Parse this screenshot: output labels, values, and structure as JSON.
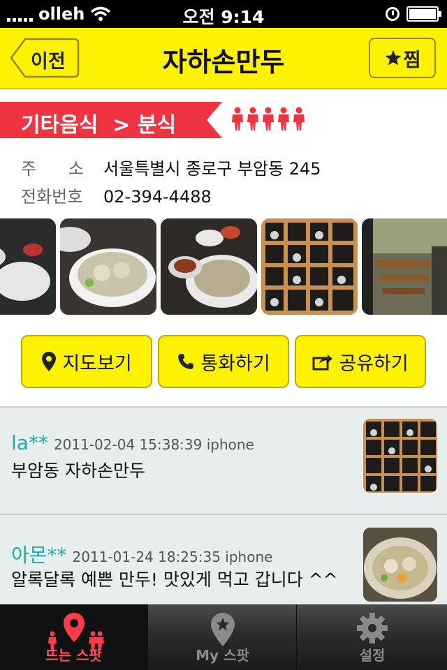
{
  "status_bar": {
    "carrier": "olleh",
    "time": "오전 9:14"
  },
  "nav": {
    "back_label": "이전",
    "title": "자하손만두",
    "zzim_label": "찜"
  },
  "category": {
    "label": "기타음식  > 분식",
    "rating_count": 5
  },
  "info": {
    "address_label": "주      소",
    "address": "서울특별시 종로구 부암동 245",
    "phone_label": "전화번호",
    "phone": "02-394-4488"
  },
  "actions": {
    "map": "지도보기",
    "call": "통화하기",
    "share": "공유하기"
  },
  "reviews": [
    {
      "user": "la**",
      "meta": "2011-02-04 15:38:39 iphone",
      "text": "부암동 자하손만두"
    },
    {
      "user": "아몬**",
      "meta": "2011-01-24 18:25:35 iphone",
      "text": "알록달록 예쁜 만두! 맛있게 먹고 갑니다 ^^"
    }
  ],
  "tabs": {
    "hot": "뜨는 스팟",
    "my": "My 스팟",
    "settings": "설정"
  },
  "colors": {
    "nav_yellow": "#fff200",
    "ribbon_red": "#ef3340",
    "accent_teal": "#1eaaa6",
    "active_tab_red": "#ff4f5a"
  }
}
